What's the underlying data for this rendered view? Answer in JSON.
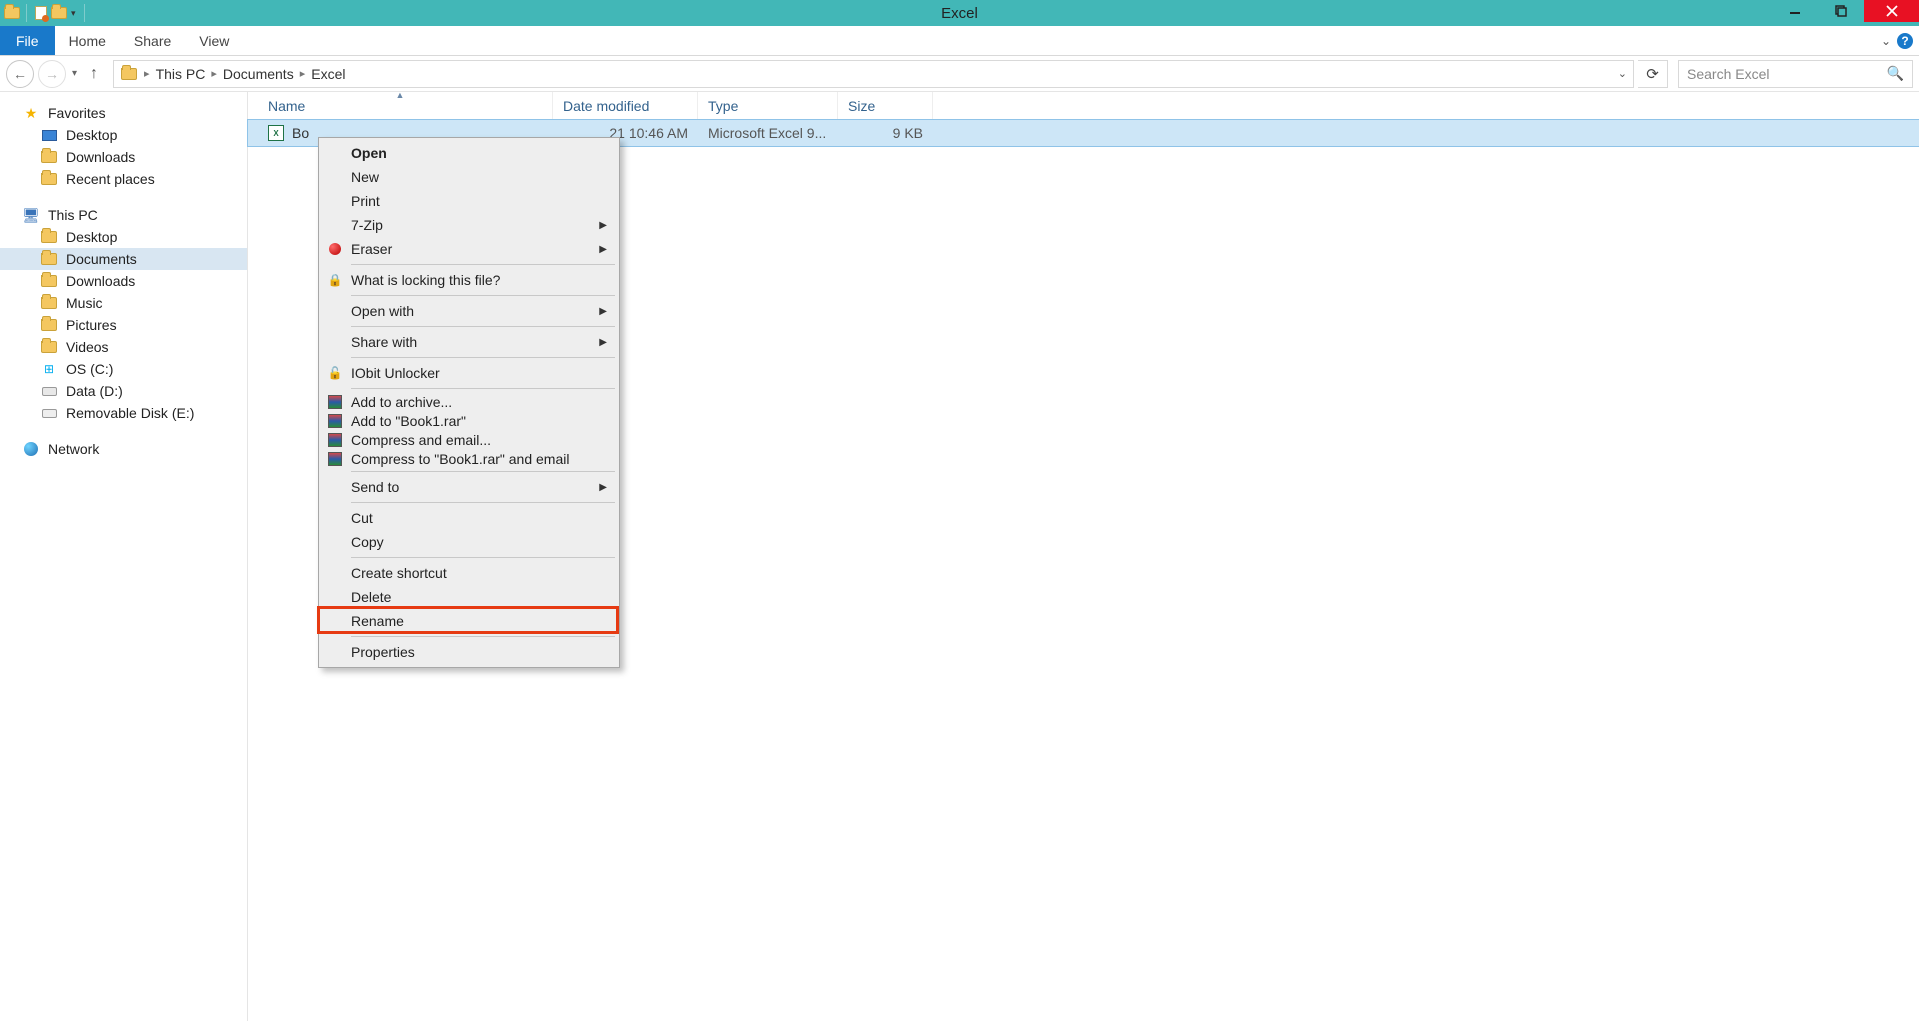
{
  "window": {
    "title": "Excel"
  },
  "ribbon": {
    "file": "File",
    "tabs": [
      "Home",
      "Share",
      "View"
    ]
  },
  "breadcrumb": [
    "This PC",
    "Documents",
    "Excel"
  ],
  "search": {
    "placeholder": "Search Excel"
  },
  "sidebar": {
    "favorites": {
      "label": "Favorites",
      "items": [
        "Desktop",
        "Downloads",
        "Recent places"
      ]
    },
    "thispc": {
      "label": "This PC",
      "items": [
        "Desktop",
        "Documents",
        "Downloads",
        "Music",
        "Pictures",
        "Videos",
        "OS (C:)",
        "Data (D:)",
        "Removable Disk (E:)"
      ]
    },
    "network": {
      "label": "Network"
    }
  },
  "columns": {
    "name": "Name",
    "date": "Date modified",
    "type": "Type",
    "size": "Size"
  },
  "file": {
    "name_visible": "Bo",
    "date_visible": "21 10:46 AM",
    "type": "Microsoft Excel 9...",
    "size": "9 KB"
  },
  "context_menu": {
    "open": "Open",
    "new": "New",
    "print": "Print",
    "sevenzip": "7-Zip",
    "eraser": "Eraser",
    "whatlock": "What is locking this file?",
    "openwith": "Open with",
    "sharewith": "Share with",
    "iobit": "IObit Unlocker",
    "addarchive": "Add to archive...",
    "addbook1": "Add to \"Book1.rar\"",
    "compressemail": "Compress and email...",
    "compressbook1email": "Compress to \"Book1.rar\" and email",
    "sendto": "Send to",
    "cut": "Cut",
    "copy": "Copy",
    "createshortcut": "Create shortcut",
    "delete": "Delete",
    "rename": "Rename",
    "properties": "Properties"
  }
}
